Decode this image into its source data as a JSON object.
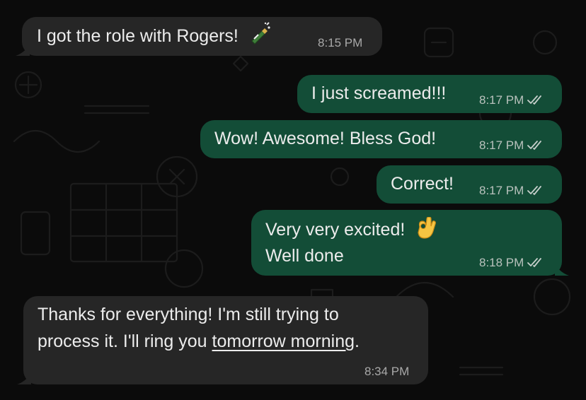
{
  "colors": {
    "background": "#0b0b0b",
    "incoming_bubble": "#262626",
    "outgoing_bubble": "#134d37",
    "text": "#ececec",
    "meta_text": "#b9c2bd"
  },
  "messages": [
    {
      "direction": "incoming",
      "text": "I got the role with Rogers!",
      "emoji": "bottle-with-popping-cork",
      "time": "8:15 PM"
    },
    {
      "direction": "outgoing",
      "text": "I just screamed!!!",
      "time": "8:17 PM",
      "status": "read"
    },
    {
      "direction": "outgoing",
      "text": "Wow! Awesome! Bless God!",
      "time": "8:17 PM",
      "status": "read"
    },
    {
      "direction": "outgoing",
      "text": "Correct!",
      "time": "8:17 PM",
      "status": "read"
    },
    {
      "direction": "outgoing",
      "line1": "Very very excited!",
      "emoji": "ok-hand",
      "line2": "Well done",
      "time": "8:18 PM",
      "status": "read"
    },
    {
      "direction": "incoming",
      "line1": "Thanks for everything! I'm still trying to",
      "line2_prefix": "process it. I'll ring you ",
      "line2_link": "tomorrow morning",
      "line2_suffix": ".",
      "time": "8:34 PM"
    }
  ]
}
